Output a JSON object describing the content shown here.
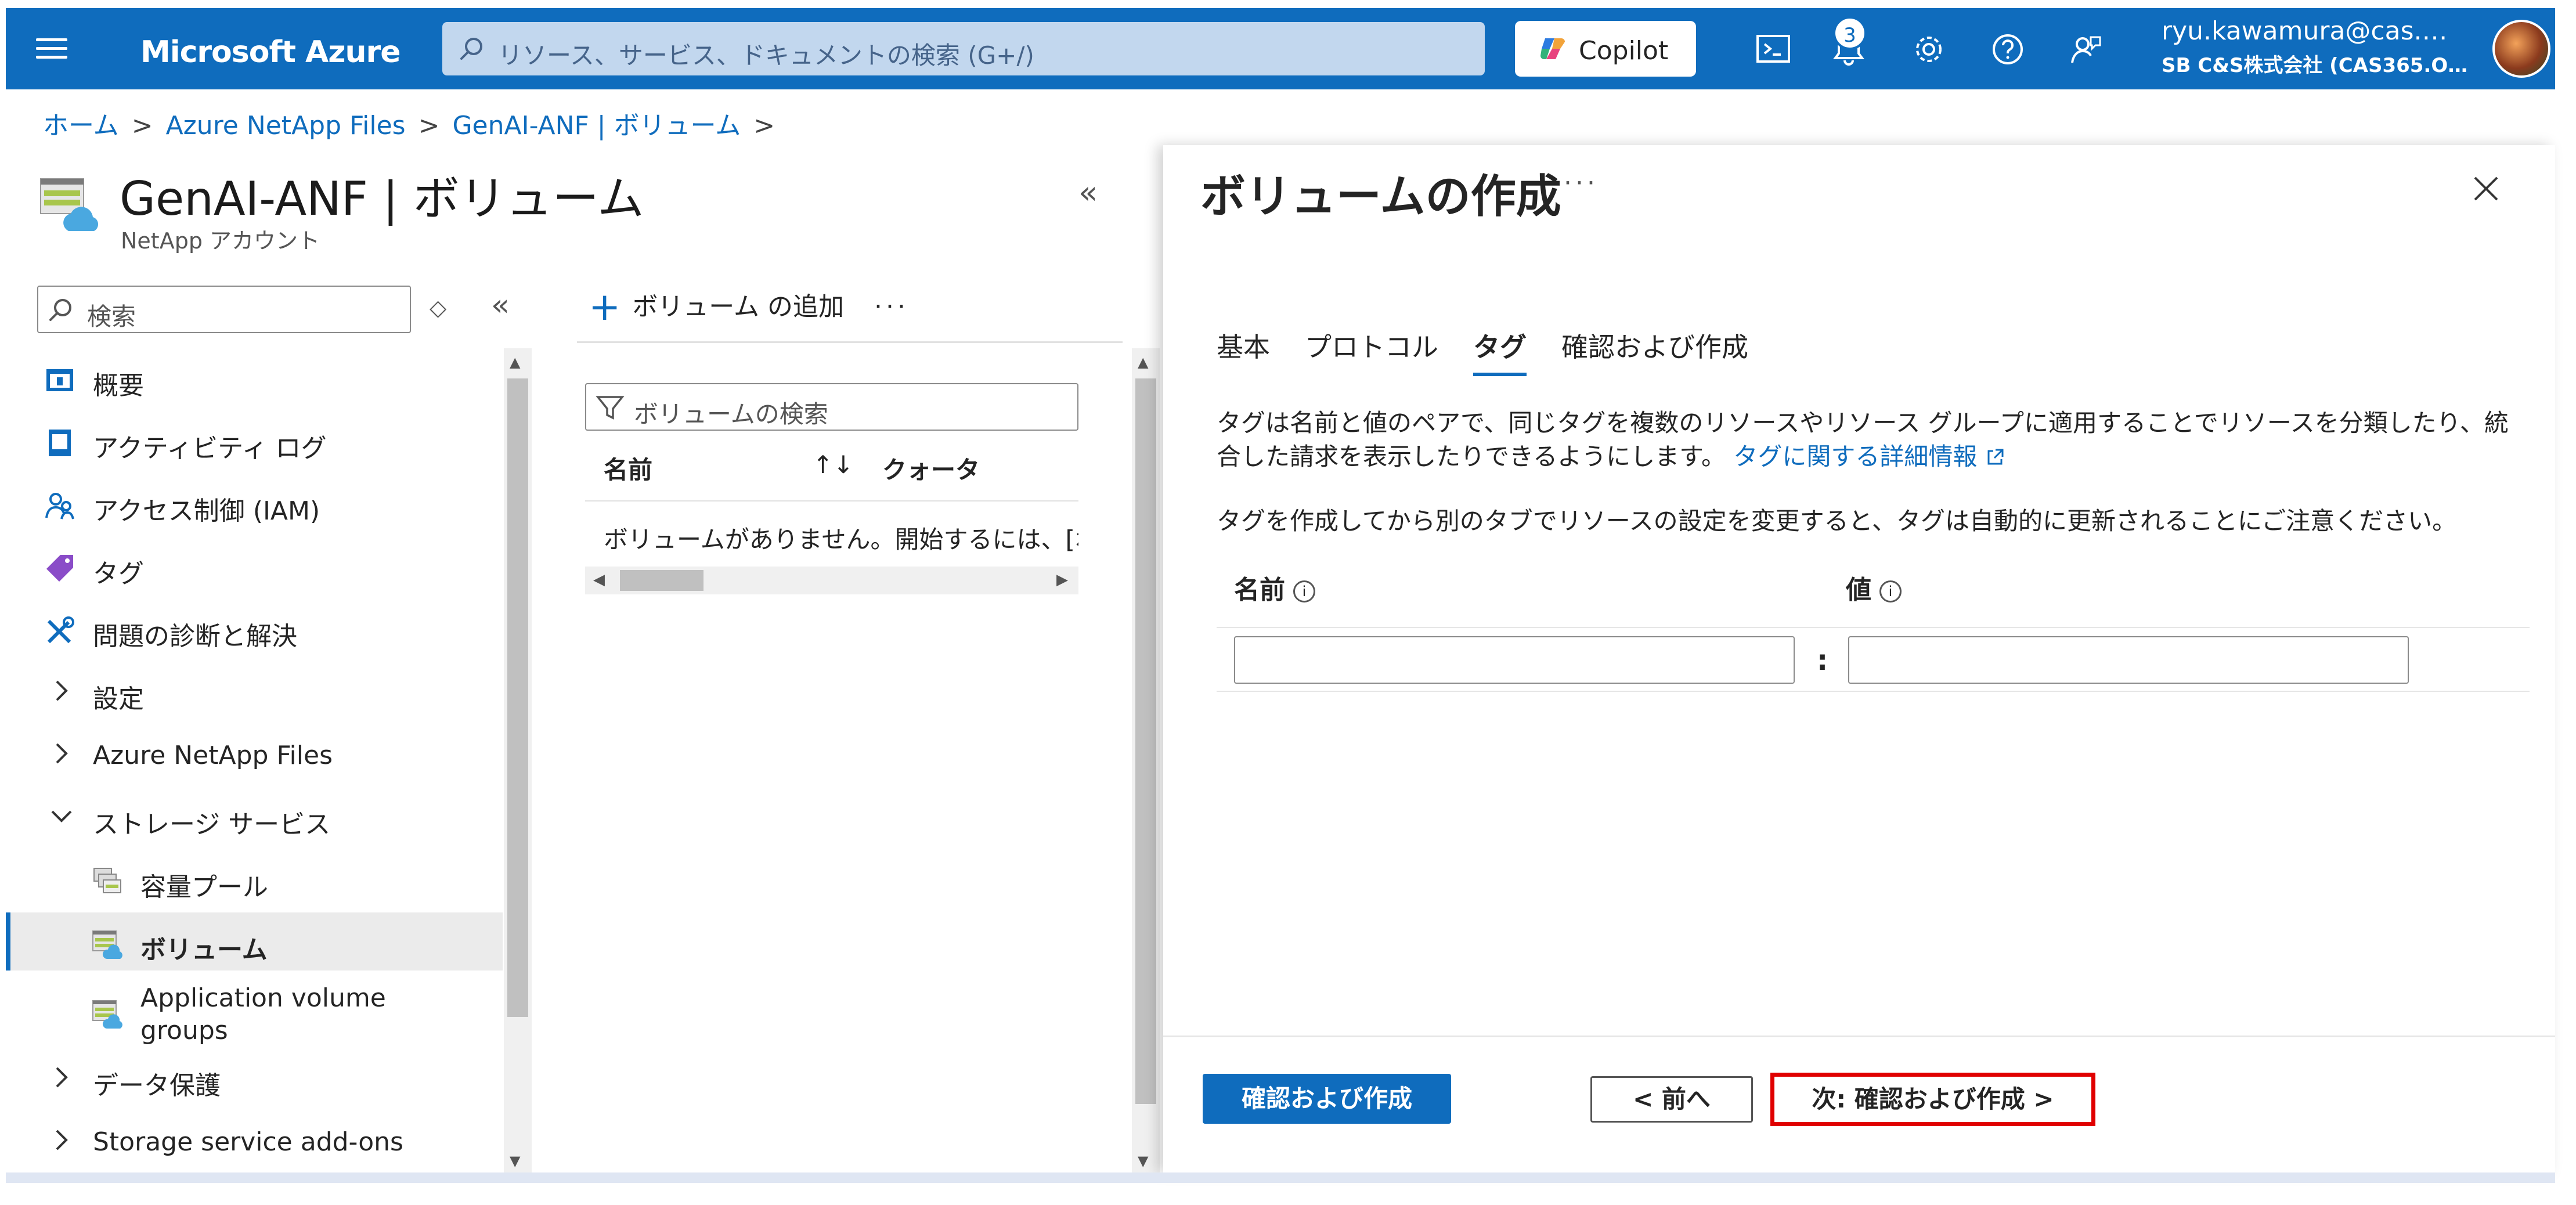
{
  "topbar": {
    "brand": "Microsoft Azure",
    "search_placeholder": "リソース、サービス、ドキュメントの検索 (G+/)",
    "copilot_label": "Copilot",
    "notification_count": "3",
    "user_email": "ryu.kawamura@cas.…",
    "user_tenant": "SB C&S株式会社 (CAS365.O…"
  },
  "breadcrumb": {
    "items": [
      "ホーム",
      "Azure NetApp Files",
      "GenAI-ANF | ボリューム"
    ],
    "separator": ">"
  },
  "blade": {
    "title": "GenAI-ANF | ボリューム",
    "subtitle": "NetApp アカウント",
    "collapse": "«"
  },
  "sidebar": {
    "search_placeholder": "検索",
    "updown": "◇",
    "collapse": "«",
    "items": [
      {
        "label": "概要"
      },
      {
        "label": "アクティビティ ログ"
      },
      {
        "label": "アクセス制御 (IAM)"
      },
      {
        "label": "タグ"
      },
      {
        "label": "問題の診断と解決"
      },
      {
        "label": "設定"
      },
      {
        "label": "Azure NetApp Files"
      },
      {
        "label": "ストレージ サービス"
      },
      {
        "label": "容量プール"
      },
      {
        "label": "ボリューム"
      },
      {
        "label": "Application volume groups"
      },
      {
        "label": "データ保護"
      },
      {
        "label": "Storage service add-ons"
      }
    ]
  },
  "middle": {
    "add_volume": "ボリューム の追加",
    "more": "···",
    "search_placeholder": "ボリュームの検索",
    "col_name": "名前",
    "col_sort": "↑↓",
    "col_quota": "クォータ",
    "empty": "ボリュームがありません。開始するには、[ボリューム の追加] をクリックしてください。"
  },
  "panel": {
    "title": "ボリュームの作成",
    "more": "···",
    "tabs": [
      "基本",
      "プロトコル",
      "タグ",
      "確認および作成"
    ],
    "active_tab": 2,
    "desc1": "タグは名前と値のペアで、同じタグを複数のリソースやリソース グループに適用することでリソースを分類したり、統合した請求を表示したりできるようにします。",
    "desc1_link": "タグに関する詳細情報",
    "desc2": "タグを作成してから別のタブでリソースの設定を変更すると、タグは自動的に更新されることにご注意ください。",
    "col_name": "名前",
    "col_value": "値",
    "info_glyph": "i",
    "colon": ":",
    "btn_review": "確認および作成",
    "btn_prev": "< 前へ",
    "btn_next": "次: 確認および作成 >"
  },
  "colors": {
    "accent": "#0f6cbd",
    "highlight": "#e00000"
  }
}
